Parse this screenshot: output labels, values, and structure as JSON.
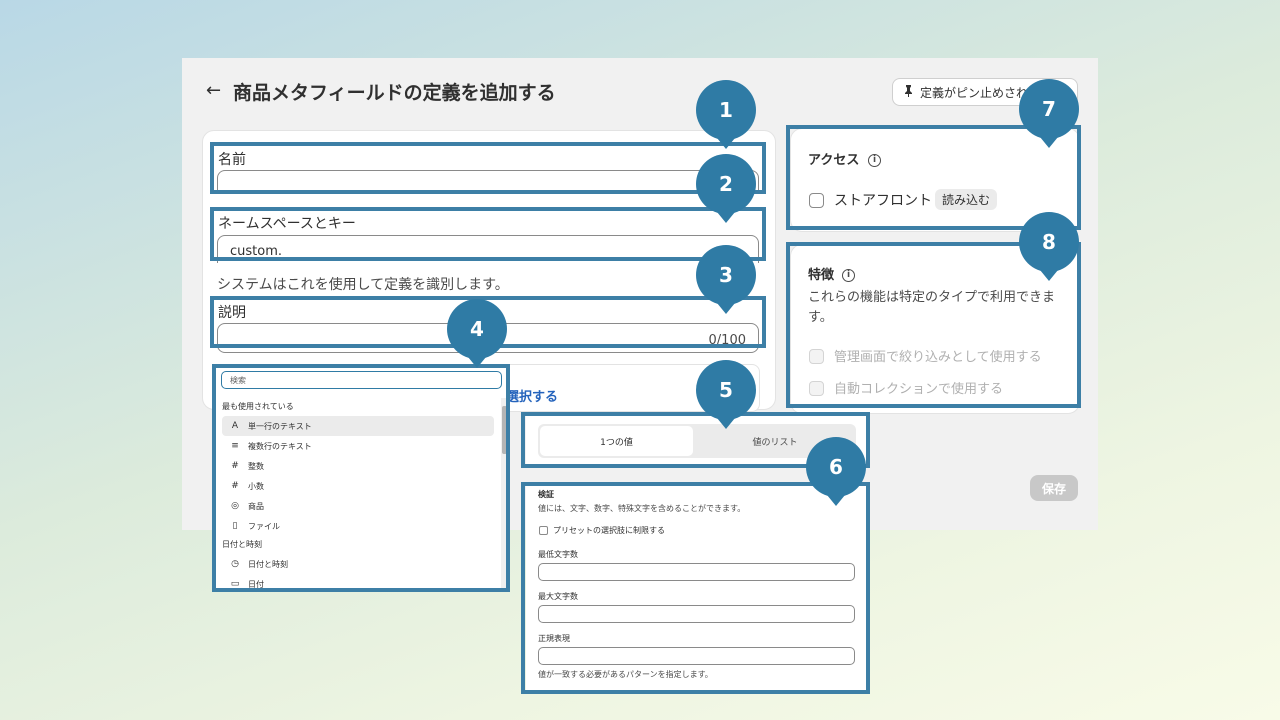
{
  "header": {
    "back_arrow": "←",
    "title": "商品メタフィールドの定義を追加する",
    "pin_button_label": "定義がピン止めされ"
  },
  "form": {
    "name_label": "名前",
    "namespace_label": "ネームスペースとキー",
    "namespace_value": "custom.",
    "namespace_help": "システムはこれを使用して定義を識別します。",
    "description_label": "説明",
    "description_counter": "0/100",
    "select_type_link": "選択する"
  },
  "type_picker": {
    "search_placeholder": "検索",
    "frequent_heading": "最も使用されている",
    "items": [
      {
        "icon": "A",
        "label": "単一行のテキスト"
      },
      {
        "icon": "≡",
        "label": "複数行のテキスト"
      },
      {
        "icon": "#",
        "label": "整数"
      },
      {
        "icon": "#",
        "label": "小数"
      },
      {
        "icon": "◎",
        "label": "商品"
      },
      {
        "icon": "▯",
        "label": "ファイル"
      }
    ],
    "datetime_heading": "日付と時刻",
    "datetime_items": [
      {
        "icon": "◷",
        "label": "日付と時刻"
      },
      {
        "icon": "▭",
        "label": "日付"
      }
    ]
  },
  "value_toggle": {
    "single": "1つの値",
    "list": "値のリスト"
  },
  "validation": {
    "title": "検証",
    "description": "値には、文字、数字、特殊文字を含めることができます。",
    "preset_label": "プリセットの選択肢に制限する",
    "min_label": "最低文字数",
    "max_label": "最大文字数",
    "regex_label": "正規表現",
    "regex_help": "値が一致する必要があるパターンを指定します。"
  },
  "access": {
    "title": "アクセス",
    "storefront_label": "ストアフロント",
    "storefront_tag": "読み込む"
  },
  "features": {
    "title": "特徴",
    "description_line1": "これらの機能は特定のタイプで利用できま",
    "description_line2": "す。",
    "filter_label": "管理画面で絞り込みとして使用する",
    "collection_label": "自動コレクションで使用する"
  },
  "save_label": "保存",
  "badges": [
    "1",
    "2",
    "3",
    "4",
    "5",
    "6",
    "7",
    "8"
  ],
  "colors": {
    "highlight": "#3d7fa6",
    "badge": "#2f7ba5",
    "link": "#2463bc"
  }
}
